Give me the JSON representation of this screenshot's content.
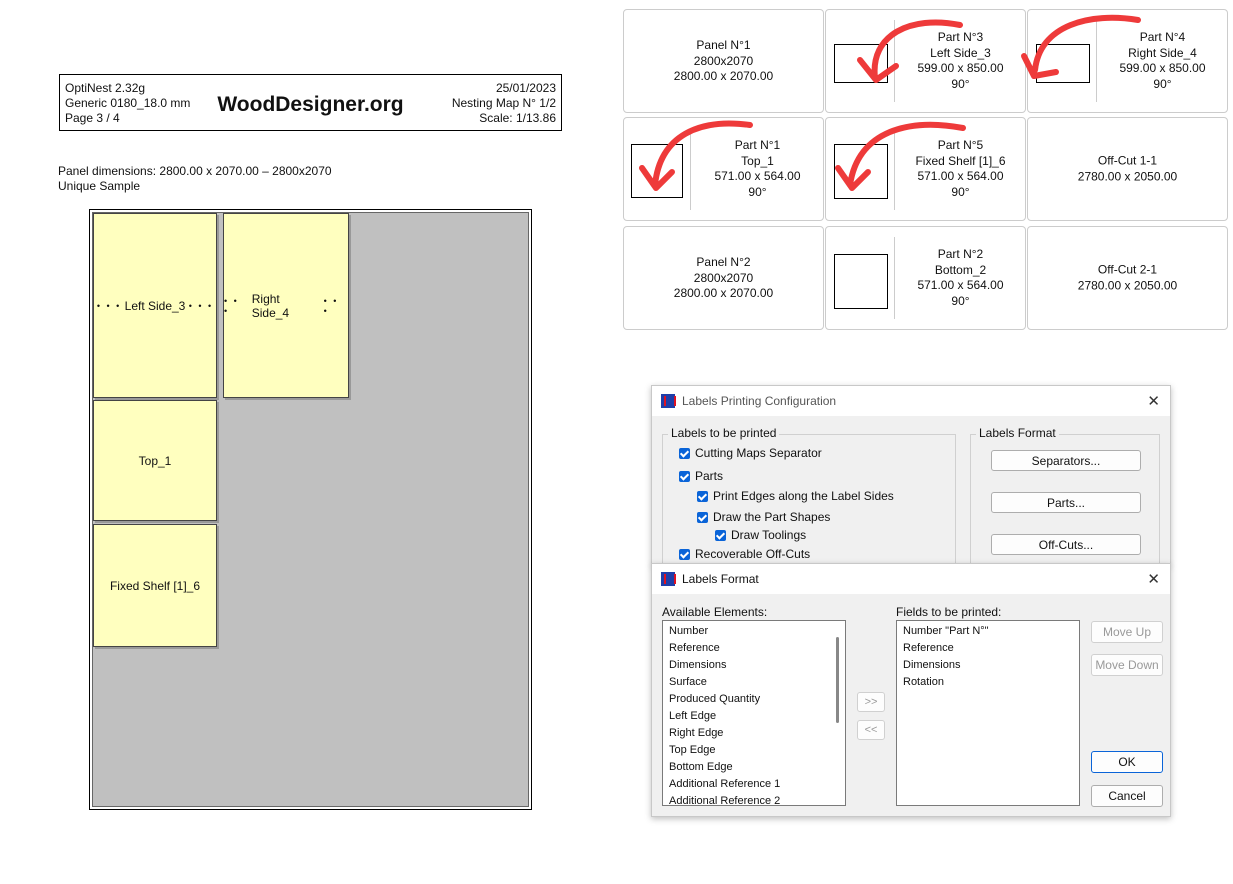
{
  "header": {
    "app": "OptiNest 2.32g",
    "material": "Generic 0180_18.0 mm",
    "page": "Page 3 / 4",
    "brand": "WoodDesigner.org",
    "date": "25/01/2023",
    "map": "Nesting Map N° 1/2",
    "scale": "Scale: 1/13.86"
  },
  "panel_info": {
    "dimensions": "Panel dimensions: 2800.00 x 2070.00 – 2800x2070",
    "sample": "Unique Sample"
  },
  "map_parts": {
    "left_side": "Left Side_3",
    "right_side": "Right Side_4",
    "top": "Top_1",
    "fixed_shelf": "Fixed Shelf [1]_6"
  },
  "labels": [
    {
      "l1": "Panel N°1",
      "l2": "2800x2070",
      "l3": "2800.00 x 2070.00"
    },
    {
      "l1": "Part N°3",
      "l2": "Left Side_3",
      "l3": "599.00 x 850.00",
      "l4": "90°"
    },
    {
      "l1": "Part N°4",
      "l2": "Right Side_4",
      "l3": "599.00 x 850.00",
      "l4": "90°"
    },
    {
      "l1": "Part N°1",
      "l2": "Top_1",
      "l3": "571.00 x 564.00",
      "l4": "90°"
    },
    {
      "l1": "Part N°5",
      "l2": "Fixed Shelf [1]_6",
      "l3": "571.00 x 564.00",
      "l4": "90°"
    },
    {
      "l1": "Off-Cut 1-1",
      "l2": "2780.00 x 2050.00"
    },
    {
      "l1": "Panel N°2",
      "l2": "2800x2070",
      "l3": "2800.00 x 2070.00"
    },
    {
      "l1": "Part N°2",
      "l2": "Bottom_2",
      "l3": "571.00 x 564.00",
      "l4": "90°"
    },
    {
      "l1": "Off-Cut 2-1",
      "l2": "2780.00 x 2050.00"
    }
  ],
  "dialog1": {
    "title": "Labels Printing Configuration",
    "group_left": "Labels to be printed",
    "group_right": "Labels Format",
    "checks": [
      "Cutting Maps Separator",
      "Parts",
      "Print Edges along the Label Sides",
      "Draw the Part Shapes",
      "Draw Toolings",
      "Recoverable Off-Cuts"
    ],
    "buttons": [
      "Separators...",
      "Parts...",
      "Off-Cuts..."
    ]
  },
  "dialog2": {
    "title": "Labels Format",
    "available_label": "Available Elements:",
    "fields_label": "Fields to be printed:",
    "available": [
      "Number",
      "Reference",
      "Dimensions",
      "Surface",
      "Produced Quantity",
      "Left Edge",
      "Right Edge",
      "Top Edge",
      "Bottom Edge",
      "Additional Reference 1",
      "Additional Reference 2"
    ],
    "fields": [
      "Number \"Part N°\"",
      "Reference",
      "Dimensions",
      "Rotation"
    ],
    "add": ">>",
    "remove": "<<",
    "move_up": "Move Up",
    "move_down": "Move Down",
    "ok": "OK",
    "cancel": "Cancel"
  },
  "colors": {
    "arrow": "#ee3a3a",
    "part_fill": "#ffffbf",
    "panel_fill": "#c0c0c0",
    "accent": "#0a64d8"
  }
}
